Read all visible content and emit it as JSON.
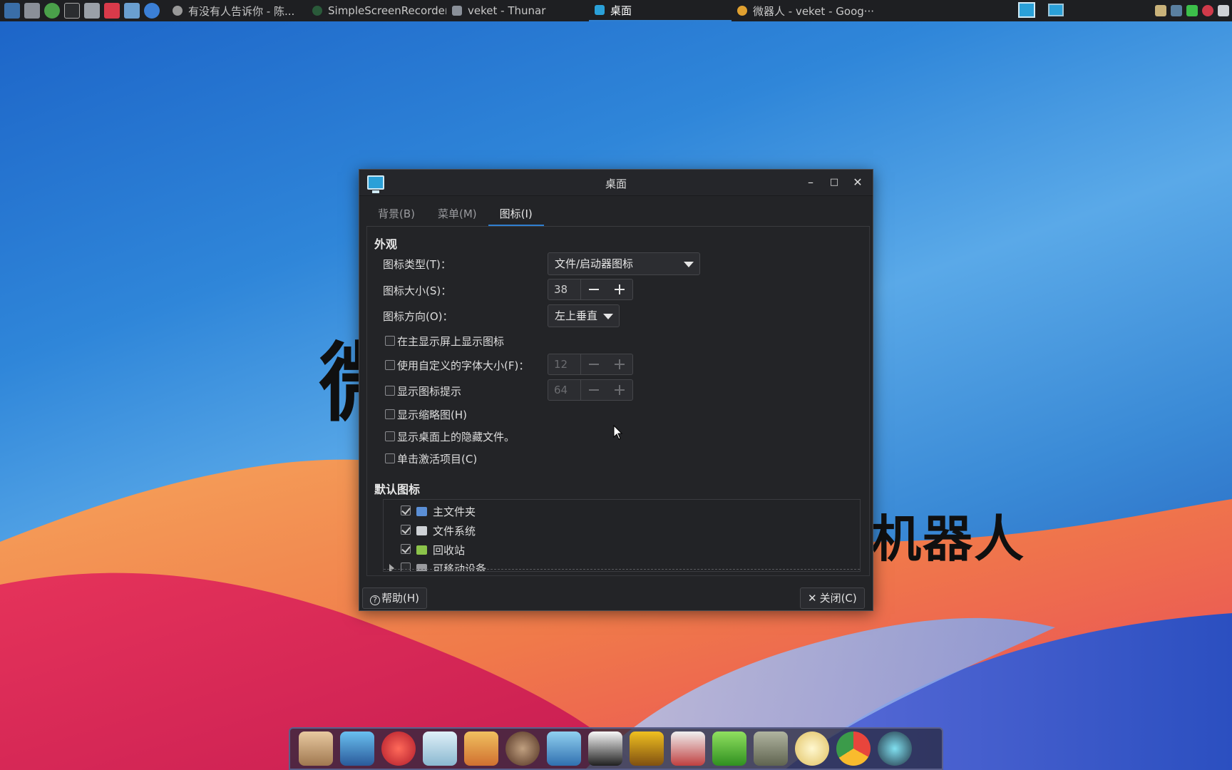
{
  "taskbar": {
    "tasks": [
      {
        "label": "有没有人告诉你 - 陈...",
        "active": false
      },
      {
        "label": "SimpleScreenRecorder",
        "active": false
      },
      {
        "label": "veket - Thunar",
        "active": false
      },
      {
        "label": "桌面",
        "active": true
      },
      {
        "label": "微器人 - veket - Goog···",
        "active": false
      }
    ]
  },
  "desktop": {
    "overlay_text_left": "微",
    "overlay_text_right": "机器人"
  },
  "dialog": {
    "title": "桌面",
    "tabs": [
      {
        "label": "背景(B)",
        "active": false
      },
      {
        "label": "菜单(M)",
        "active": false
      },
      {
        "label": "图标(I)",
        "active": true
      }
    ],
    "appearance": {
      "section_title": "外观",
      "icon_type_label": "图标类型(T)：",
      "icon_type_value": "文件/启动器图标",
      "icon_size_label": "图标大小(S)：",
      "icon_size_value": "38",
      "icon_orientation_label": "图标方向(O)：",
      "icon_orientation_value": "左上垂直",
      "show_on_primary": {
        "label": "在主显示屏上显示图标",
        "checked": false
      },
      "custom_font_size": {
        "label": "使用自定义的字体大小(F)：",
        "checked": false,
        "value": "12"
      },
      "show_tooltips": {
        "label": "显示图标提示",
        "checked": false,
        "value": "64"
      },
      "show_thumbnails": {
        "label": "显示缩略图(H)",
        "checked": false
      },
      "show_hidden": {
        "label": "显示桌面上的隐藏文件。",
        "checked": false
      },
      "single_click": {
        "label": "单击激活项目(C)",
        "checked": false
      }
    },
    "default_icons": {
      "section_title": "默认图标",
      "items": [
        {
          "label": "主文件夹",
          "checked": true,
          "icon": "home-folder-icon",
          "color": "#5b8fd6"
        },
        {
          "label": "文件系统",
          "checked": true,
          "icon": "drive-icon",
          "color": "#cfd2d6"
        },
        {
          "label": "回收站",
          "checked": true,
          "icon": "trash-icon",
          "color": "#8bc34a"
        },
        {
          "label": "可移动设备",
          "checked": false,
          "icon": "removable-drive-icon",
          "color": "#9a9b9f"
        }
      ]
    },
    "help_button": "帮助(H)",
    "close_button": "关闭(C)"
  },
  "colors": {
    "accent": "#2f7fd0",
    "dialog_bg": "#232427",
    "panel_bg": "#1e1f22"
  }
}
